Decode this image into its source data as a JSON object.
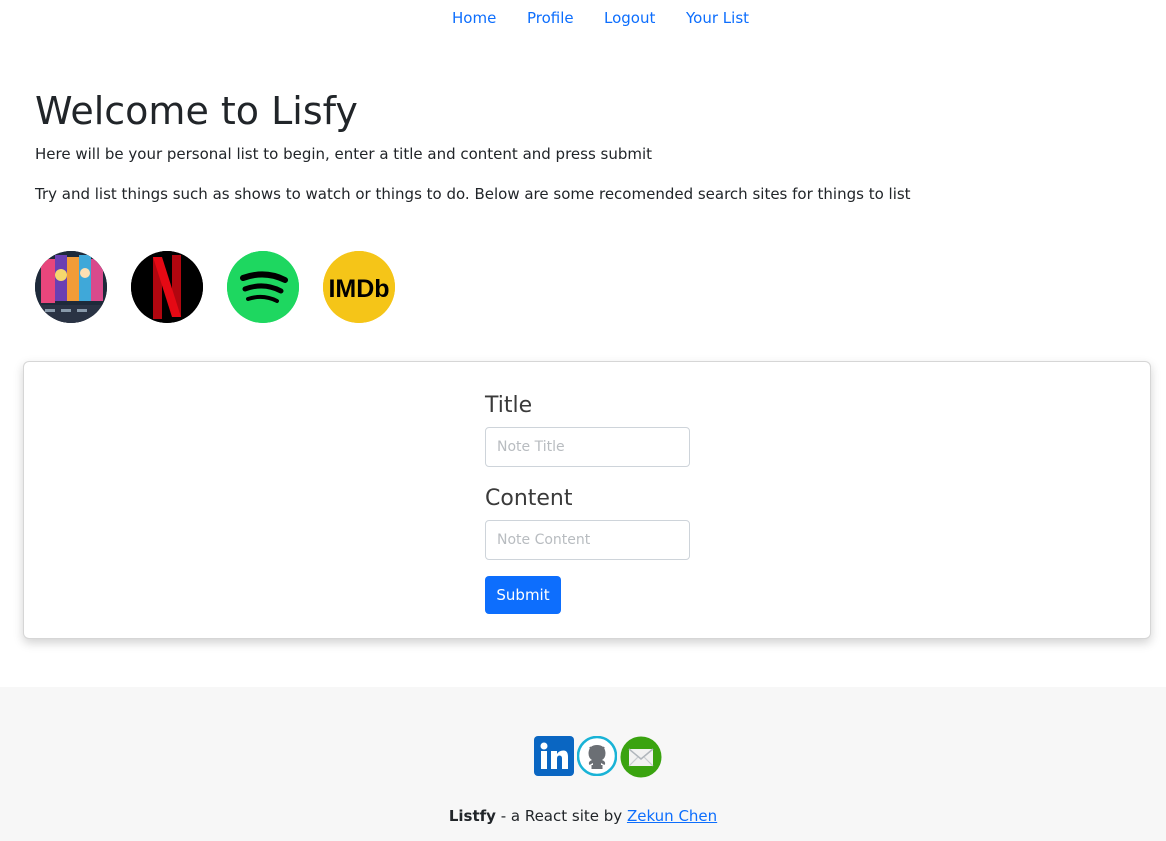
{
  "nav": {
    "items": [
      {
        "label": "Home"
      },
      {
        "label": "Profile"
      },
      {
        "label": "Logout"
      },
      {
        "label": "Your List"
      }
    ]
  },
  "hero": {
    "title": "Welcome to Lisfy",
    "intro": "Here will be your personal list to begin, enter a title and content and press submit",
    "hint": "Try and list things such as shows to watch or things to do. Below are some recomended search sites for things to list"
  },
  "sites": [
    {
      "icon": "crunchyroll-icon",
      "color": "#1e2a3a"
    },
    {
      "icon": "netflix-icon",
      "color": "#000000"
    },
    {
      "icon": "spotify-icon",
      "color": "#1ed760"
    },
    {
      "icon": "imdb-icon",
      "color": "#f5c518",
      "text": "IMDb"
    }
  ],
  "form": {
    "title_label": "Title",
    "title_placeholder": "Note Title",
    "title_value": "",
    "content_label": "Content",
    "content_placeholder": "Note Content",
    "content_value": "",
    "submit_label": "Submit",
    "accent": "#0d6efd"
  },
  "footer": {
    "social": [
      "linkedin-icon",
      "github-icon",
      "mail-icon"
    ],
    "brand": "Listfy",
    "tagline": " - a React site by ",
    "author": "Zekun Chen"
  }
}
